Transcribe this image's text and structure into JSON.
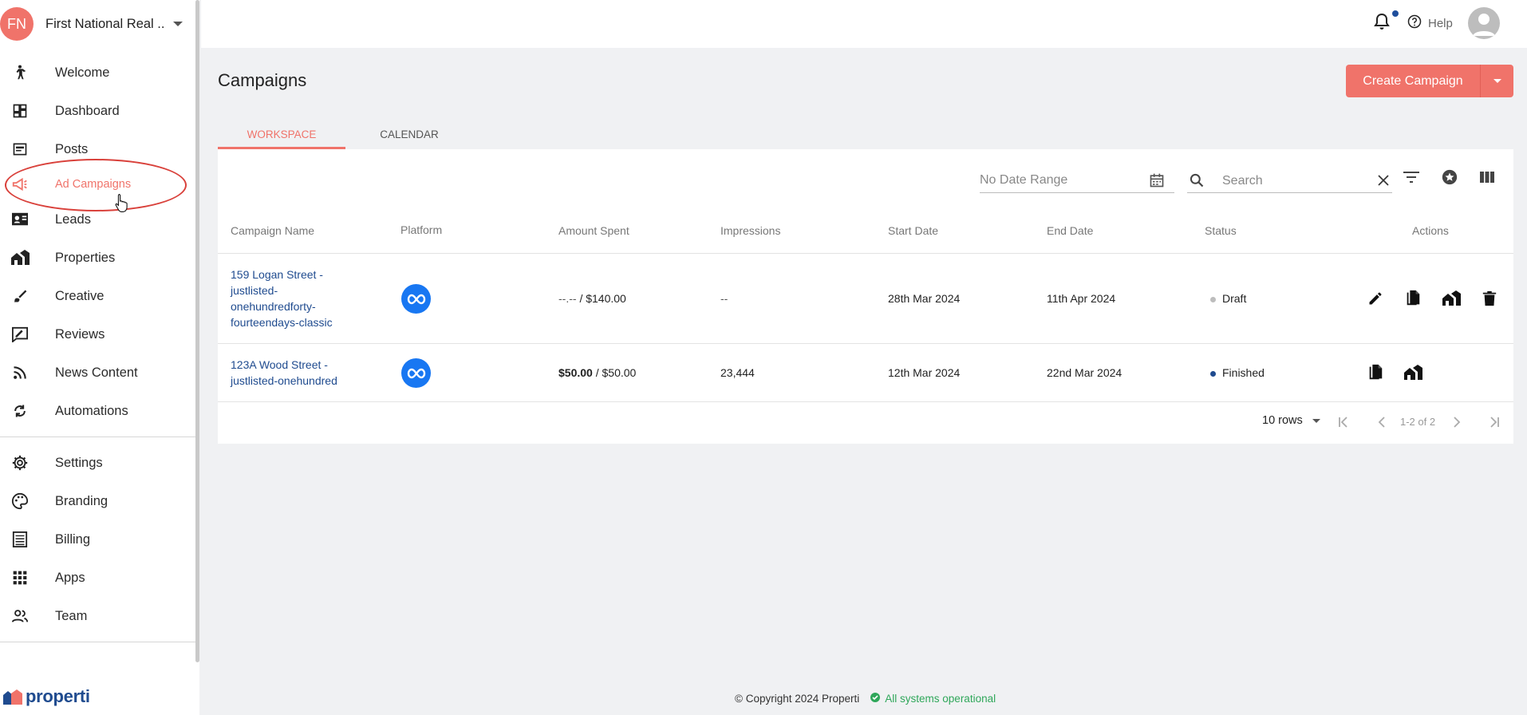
{
  "org": {
    "initials": "FN",
    "name": "First National Real ..."
  },
  "nav": {
    "items": [
      {
        "label": "Welcome",
        "icon": "walking-person-icon"
      },
      {
        "label": "Dashboard",
        "icon": "dashboard-icon"
      },
      {
        "label": "Posts",
        "icon": "posts-icon"
      },
      {
        "label": "Ad Campaigns",
        "icon": "megaphone-icon",
        "active": true
      },
      {
        "label": "Leads",
        "icon": "contact-card-icon"
      },
      {
        "label": "Properties",
        "icon": "houses-icon"
      },
      {
        "label": "Creative",
        "icon": "brush-icon"
      },
      {
        "label": "Reviews",
        "icon": "rate-review-icon"
      },
      {
        "label": "News Content",
        "icon": "rss-icon"
      },
      {
        "label": "Automations",
        "icon": "refresh-icon"
      }
    ],
    "secondary": [
      {
        "label": "Settings",
        "icon": "gear-icon"
      },
      {
        "label": "Branding",
        "icon": "palette-icon"
      },
      {
        "label": "Billing",
        "icon": "receipt-icon"
      },
      {
        "label": "Apps",
        "icon": "apps-grid-icon"
      },
      {
        "label": "Team",
        "icon": "team-icon"
      }
    ]
  },
  "brand": {
    "name": "properti"
  },
  "topbar": {
    "help_label": "Help"
  },
  "page": {
    "title": "Campaigns",
    "create_label": "Create Campaign"
  },
  "tabs": [
    {
      "label": "WORKSPACE",
      "active": true
    },
    {
      "label": "CALENDAR"
    }
  ],
  "filters": {
    "date_placeholder": "No Date Range",
    "search_placeholder": "Search"
  },
  "table": {
    "headers": [
      "Campaign Name",
      "Platform",
      "Amount Spent",
      "Impressions",
      "Start Date",
      "End Date",
      "Status",
      "Actions"
    ],
    "rows": [
      {
        "name": "159 Logan Street - justlisted-onehundredforty-fourteendays-classic",
        "name_lines": [
          "159 Logan Street -",
          "justlisted-",
          "onehundredforty-",
          "fourteendays-classic"
        ],
        "platform": "meta-icon",
        "spent": "--.-- ",
        "budget": "/ $140.00",
        "impressions": "--",
        "start": "28th Mar 2024",
        "end": "11th Apr 2024",
        "status": "Draft",
        "status_color": "#bdbdbd",
        "actions": [
          "edit-icon",
          "duplicate-icon",
          "property-icon",
          "delete-icon"
        ]
      },
      {
        "name": "123A Wood Street - justlisted-onehundred",
        "name_lines": [
          "123A Wood Street -",
          "justlisted-onehundred"
        ],
        "platform": "meta-icon",
        "spent": "$50.00",
        "budget": " / $50.00",
        "impressions": "23,444",
        "start": "12th Mar 2024",
        "end": "22nd Mar 2024",
        "status": "Finished",
        "status_color": "#1f4b8f",
        "actions": [
          "duplicate-icon",
          "property-icon"
        ]
      }
    ]
  },
  "pagination": {
    "rows_label": "10 rows",
    "info": "1-2 of 2"
  },
  "footer": {
    "copyright": "© Copyright 2024 Properti",
    "status": "All systems operational"
  },
  "colors": {
    "accent": "#f0736a",
    "link": "#1f4b8f",
    "meta": "#1877f2",
    "ok": "#2fa75a"
  }
}
